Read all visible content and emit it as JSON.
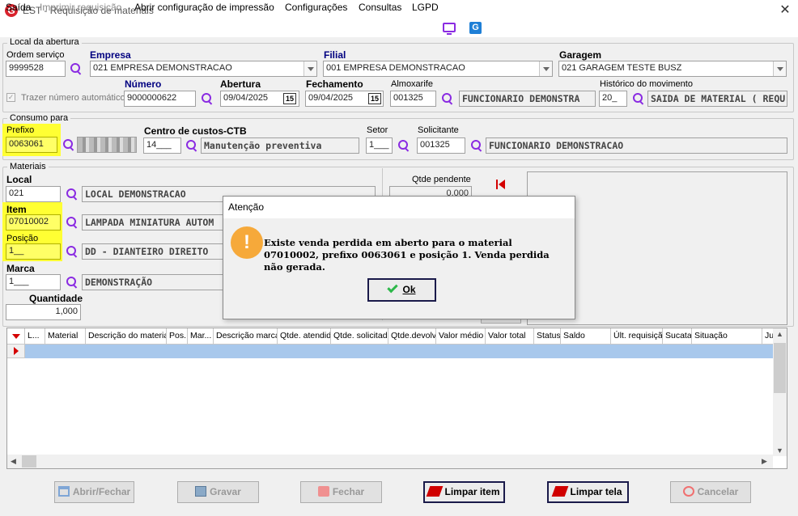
{
  "window": {
    "title": "EST - Requisição de materiais",
    "logo": "G",
    "close": "✕"
  },
  "menu": {
    "items": [
      "Saída",
      "Imprimir requisição",
      "Abrir configuração de impressão",
      "Configurações",
      "Consultas",
      "LGPD"
    ],
    "icons": [
      "monitor-icon",
      "g-icon"
    ]
  },
  "abertura": {
    "legend": "Local da abertura",
    "ordem_servico_label": "Ordem serviço",
    "ordem_servico": "9999528",
    "empresa_label": "Empresa",
    "empresa": "021 EMPRESA DEMONSTRACAO",
    "filial_label": "Filial",
    "filial": "001 EMPRESA DEMONSTRACAO",
    "garagem_label": "Garagem",
    "garagem": "021 GARAGEM TESTE BUSZ",
    "trazer_numero": "Trazer número automático",
    "numero_label": "Número",
    "numero": "9000000622",
    "abertura_label": "Abertura",
    "abertura": "09/04/2025",
    "fechamento_label": "Fechamento",
    "fechamento": "09/04/2025",
    "cal_label": "15",
    "almoxarife_label": "Almoxarife",
    "almoxarife_code": "001325",
    "almoxarife_name": "FUNCIONARIO DEMONSTRA",
    "historico_label": "Histórico do movimento",
    "historico_code": "20_",
    "historico_name": "SAIDA DE MATERIAL ( REQU"
  },
  "consumo": {
    "legend": "Consumo para",
    "prefixo_label": "Prefixo",
    "prefixo": "0063061",
    "centro_label": "Centro de custos-CTB",
    "centro_code": "14___",
    "centro_name": "Manutenção preventiva",
    "setor_label": "Setor",
    "setor": "1___",
    "solicitante_label": "Solicitante",
    "solicitante_code": "001325",
    "solicitante_name": "FUNCIONARIO DEMONSTRACAO"
  },
  "materiais": {
    "legend": "Materiais",
    "local_label": "Local",
    "local_code": "021",
    "local_name": "LOCAL DEMONSTRACAO",
    "item_label": "Item",
    "item_code": "07010002",
    "item_name": "LAMPADA MINIATURA AUTOM",
    "posicao_label": "Posição",
    "posicao_code": "1__",
    "posicao_name": "DD - DIANTEIRO DIREITO",
    "marca_label": "Marca",
    "marca_code": "1___",
    "marca_name": "DEMONSTRAÇÃO",
    "quantidade_label": "Quantidade",
    "quantidade": "1,000",
    "qtde_pendente_label": "Qtde pendente",
    "qtde_pendente": "0,000"
  },
  "table": {
    "columns": [
      "L...",
      "Material",
      "Descrição do material",
      "Pos.",
      "Mar...",
      "Descrição marca",
      "Qtde. atendida",
      "Qtde. solicitada",
      "Qtde.devolv.",
      "Valor médio",
      "Valor total",
      "Status",
      "Saldo",
      "Últ. requisição",
      "Sucata",
      "Situação",
      "Ju"
    ]
  },
  "buttons": {
    "abrir": "Abrir/Fechar",
    "gravar": "Gravar",
    "fechar": "Fechar",
    "limpar_item": "Limpar item",
    "limpar_tela": "Limpar tela",
    "cancelar": "Cancelar"
  },
  "dialog": {
    "title": "Atenção",
    "icon": "!",
    "message": "Existe venda perdida em aberto para o material 07010002, prefixo 0063061 e posição 1. Venda perdida não gerada.",
    "ok": "Ok"
  },
  "colors": {
    "highlight": "#ffff33",
    "accent": "#8a2be2",
    "selection": "#a8c8ec",
    "warning": "#f6a93a"
  }
}
